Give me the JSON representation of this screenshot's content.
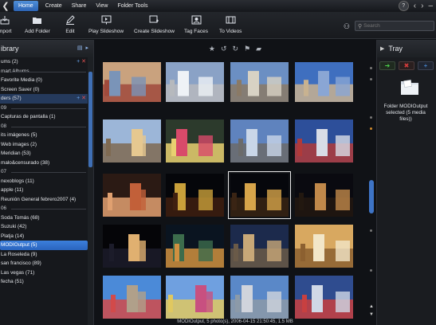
{
  "menubar": {
    "items": [
      {
        "label": "Home",
        "active": true
      },
      {
        "label": "Create",
        "active": false
      },
      {
        "label": "Share",
        "active": false
      },
      {
        "label": "View",
        "active": false
      },
      {
        "label": "Folder Tools",
        "active": false
      }
    ]
  },
  "toolbar": {
    "buttons": [
      {
        "label": "mport",
        "icon": "import-icon"
      },
      {
        "label": "Add Folder",
        "icon": "add-folder-icon"
      },
      {
        "label": "Edit",
        "icon": "edit-icon"
      },
      {
        "label": "Play Slideshow",
        "icon": "play-slideshow-icon"
      },
      {
        "label": "Create Slideshow",
        "icon": "create-slideshow-icon"
      },
      {
        "label": "Tag Faces",
        "icon": "tag-faces-icon"
      },
      {
        "label": "To Videos",
        "icon": "to-videos-icon"
      }
    ],
    "search_placeholder": "Search"
  },
  "library": {
    "title": "ibrary",
    "rows": [
      {
        "label": "ums (2)",
        "type": "item",
        "style": "plus"
      },
      {
        "label": "mart Albums",
        "type": "section"
      },
      {
        "label": "Favorite Media (0)",
        "type": "item"
      },
      {
        "label": "Screen Saver (0)",
        "type": "item"
      },
      {
        "label": "ders (57)",
        "type": "item",
        "style": "hl-plus"
      },
      {
        "label": "09",
        "type": "section"
      },
      {
        "label": "Capturas de pantalla (1)",
        "type": "item"
      },
      {
        "label": "08",
        "type": "section"
      },
      {
        "label": "its imágenes (5)",
        "type": "item"
      },
      {
        "label": "Web images (2)",
        "type": "item"
      },
      {
        "label": "Meridian (53)",
        "type": "item"
      },
      {
        "label": "malo&censurado (38)",
        "type": "item"
      },
      {
        "label": "07",
        "type": "section"
      },
      {
        "label": "nexoblogs (11)",
        "type": "item"
      },
      {
        "label": "apple (11)",
        "type": "item"
      },
      {
        "label": "Reunión General febrero2007 (4)",
        "type": "item"
      },
      {
        "label": "06",
        "type": "section"
      },
      {
        "label": "Soda Tomás (68)",
        "type": "item"
      },
      {
        "label": "Suzuki (42)",
        "type": "item"
      },
      {
        "label": "Platja (14)",
        "type": "item"
      },
      {
        "label": "MODIOutput (5)",
        "type": "selected"
      },
      {
        "label": "La Roseleda (9)",
        "type": "item"
      },
      {
        "label": "san francisco (89)",
        "type": "item"
      },
      {
        "label": "Las vegas (71)",
        "type": "item"
      },
      {
        "label": "fecha (51)",
        "type": "item"
      }
    ]
  },
  "tray": {
    "title": "Tray",
    "folder_text": "Folder MODIOutput selected (5 media files))"
  },
  "statusbar": {
    "text": "MODIOutput, 5 photo(s), 2006-04-15 21:50:45, 1.5 MB"
  },
  "colors": {
    "accent": "#3b7ddc",
    "background": "#101216"
  }
}
